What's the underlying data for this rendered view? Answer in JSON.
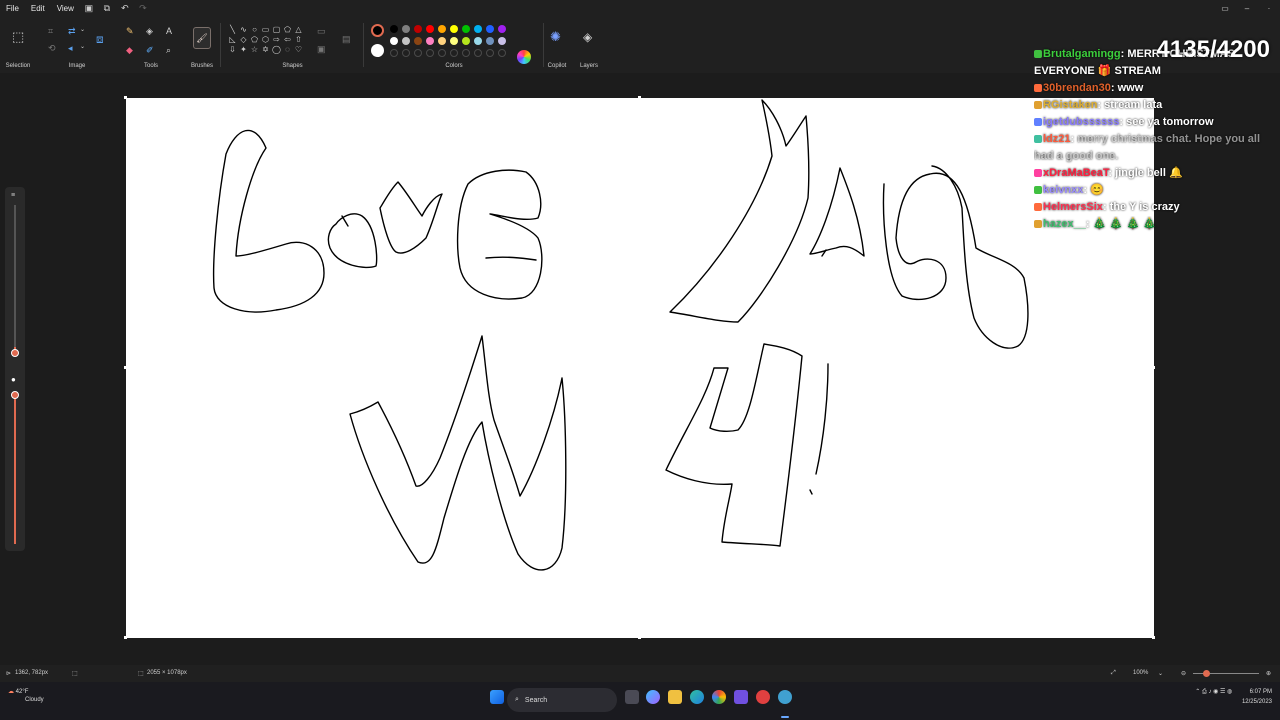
{
  "menu": {
    "file": "File",
    "edit": "Edit",
    "view": "View"
  },
  "ribbon": {
    "selection": "Selection",
    "image": "Image",
    "tools": "Tools",
    "brushes": "Brushes",
    "shapes": "Shapes",
    "colors": "Colors",
    "copilot": "Copilot",
    "layers": "Layers",
    "text_tool": "A"
  },
  "colors": {
    "primary": "#000000",
    "secondary": "#ffffff",
    "palette": [
      "#000000",
      "#7f7f7f",
      "#c00000",
      "#ff0000",
      "#ffa500",
      "#ffff00",
      "#00c000",
      "#00b0f0",
      "#2060ff",
      "#a020f0",
      "#ffffff",
      "#c3c3c3",
      "#8b4513",
      "#ff80c0",
      "#ffd27f",
      "#ffff80",
      "#b5e61d",
      "#99d9ea",
      "#7092be",
      "#c8bfe7"
    ]
  },
  "stream": {
    "counter": "4135/4200",
    "chat": [
      {
        "user": "Brutalgamingg",
        "color": "#3ccf3c",
        "text": "MERRY CHRISTMAS EVERYONE 🎁 STREAM",
        "faint": false
      },
      {
        "user": "30brendan30",
        "color": "#e0602a",
        "text": "www",
        "faint": false
      },
      {
        "user": "RGistaken",
        "color": "#e0b030",
        "text": "stream lata",
        "faint": false
      },
      {
        "user": "igetdubssssss",
        "color": "#8a7cff",
        "text": "see ya tomorrow",
        "faint": false
      },
      {
        "user": "ldz21",
        "color": "#ff5a3c",
        "text": "merry christmas chat. Hope you all had a good one.",
        "faint": true
      },
      {
        "user": "xDraMaBeaT",
        "color": "#ff2040",
        "text": "jingle bell 🔔",
        "faint": false
      },
      {
        "user": "keivnxx",
        "color": "#9a8cff",
        "text": "😊",
        "faint": false
      },
      {
        "user": "HelmersSix",
        "color": "#ff3050",
        "text": "the Y is crazy",
        "faint": false
      },
      {
        "user": "hazex__",
        "color": "#40c070",
        "text": "🎄 🎄 🎄 🎄",
        "faint": false
      }
    ]
  },
  "status": {
    "cursor": "1362, 782px",
    "canvas_size": "2055 × 1078px",
    "zoom": "100%"
  },
  "taskbar": {
    "weather_temp": "42°F",
    "weather_cond": "Cloudy",
    "search": "Search",
    "time": "6:07 PM",
    "date": "12/25/2023"
  }
}
